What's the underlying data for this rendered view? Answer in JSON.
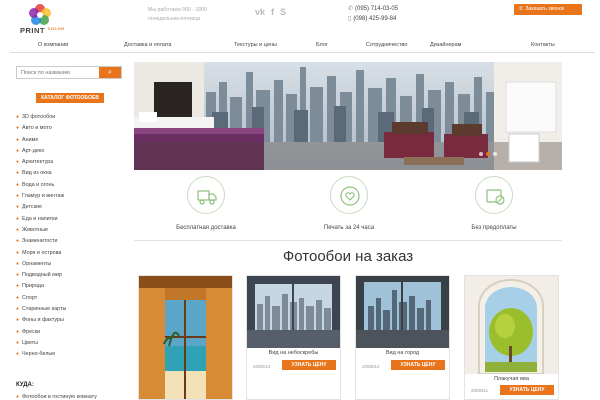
{
  "header": {
    "logo_main": "PRINT",
    "logo_sub": "COLOR",
    "hours_line1": "Мы работаем 900 - 1800",
    "hours_line2": "понедельник-пятница",
    "social_icons": [
      "vk-icon",
      "facebook-icon",
      "skype-icon"
    ],
    "phone1": "(095) 714-03-05",
    "phone2": "(098) 425-99-84",
    "callback_label": "Заказать звонок"
  },
  "nav": {
    "items": [
      "О компании",
      "Доставка и оплата",
      "Текстуры и цены",
      "Блог",
      "Сотрудничество",
      "Дизайнерам",
      "Контакты"
    ]
  },
  "sidebar": {
    "search_placeholder": "Поиск по названию",
    "search_button_icon": "search-icon",
    "catalog_label": "КАТАЛОГ ФОТООБОЕВ",
    "categories": [
      "3D фотообои",
      "Авто и мото",
      "Аниме",
      "Арт-деко",
      "Архитектура",
      "Вид из окна",
      "Вода и огонь",
      "Гламур и винтаж",
      "Детские",
      "Еда и напитки",
      "Животные",
      "Знаменитости",
      "Моря и острова",
      "Орнаменты",
      "Подводный мир",
      "Природа",
      "Спорт",
      "Старинные карты",
      "Фоны и фактуры",
      "Фрески",
      "Цветы",
      "Черно-белые"
    ],
    "kuda_title": "КУДА:",
    "kuda_item": "Фотообои в гостиную комнату"
  },
  "features": [
    {
      "label": "Бесплатная доставка",
      "icon": "delivery-truck-icon"
    },
    {
      "label": "Печать за 24 часа",
      "icon": "heart-clock-icon"
    },
    {
      "label": "Без предоплаты",
      "icon": "no-prepayment-icon"
    }
  ],
  "section_title": "Фотообои на заказ",
  "products": [
    {
      "name": "",
      "code": "",
      "button": ""
    },
    {
      "name": "Вид на небоскребы",
      "code": "2006013",
      "button": "УЗНАТЬ ЦЕНУ"
    },
    {
      "name": "Вид на город",
      "code": "2006012",
      "button": "УЗНАТЬ ЦЕНУ"
    },
    {
      "name": "Плакучая ива",
      "code": "2006011",
      "button": "УЗНАТЬ ЦЕНУ"
    }
  ],
  "colors": {
    "accent": "#e8741c"
  }
}
